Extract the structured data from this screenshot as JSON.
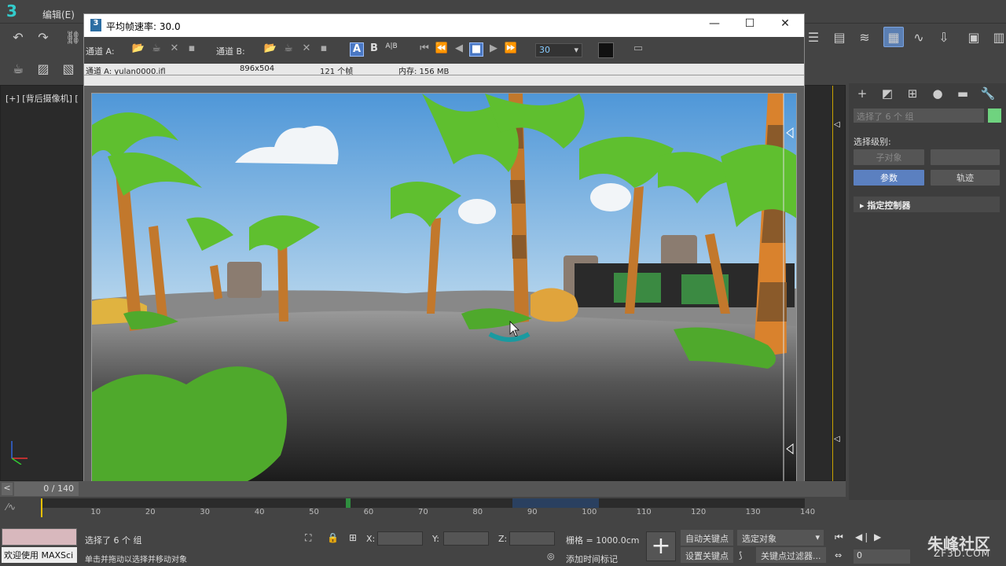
{
  "app": {
    "menu": [
      "编辑(E)"
    ],
    "viewport_label": "[+] [背后摄像机] [",
    "side": {
      "selection_text": "选择了 6 个 组",
      "select_level_label": "选择级别:",
      "sub_object_btn": "子对象",
      "params_btn": "参数",
      "track_btn": "轨迹",
      "rollout_title": "指定控制器"
    },
    "timeline": {
      "frame_readout": "0 / 140",
      "ticks": [
        "10",
        "20",
        "30",
        "40",
        "50",
        "60",
        "70",
        "80",
        "90",
        "100",
        "110",
        "120",
        "130",
        "140"
      ]
    },
    "status": {
      "selection": "选择了 6 个 组",
      "hint": "单击并拖动以选择并移动对象",
      "welcome": "欢迎使用 MAXSci",
      "x_label": "X:",
      "y_label": "Y:",
      "z_label": "Z:",
      "grid": "栅格 = 1000.0cm",
      "add_time_tag": "添加时间标记",
      "auto_key": "自动关键点",
      "set_key": "设置关键点",
      "selected_object": "选定对象",
      "key_filter": "关键点过滤器...",
      "frame_value": "0"
    },
    "watermark": {
      "brand": "朱峰社区",
      "url": "ZF3D.COM"
    }
  },
  "frame_window": {
    "title": "平均帧速率: 30.0",
    "icon_text": "3",
    "channel_a_label": "通道 A:",
    "channel_b_label": "通道 B:",
    "btn_a": "A",
    "btn_b": "B",
    "btn_ab": "A|B",
    "frame_rate": "30",
    "info": {
      "channel": "通道 A: yulan0000.ifl",
      "resolution": "896x504",
      "frames": "121 个帧",
      "memory": "内存: 156 MB"
    }
  },
  "colors": {
    "sky_top": "#4f97d8",
    "accent_blue": "#5b80c0",
    "selection_swatch": "#6fd37f",
    "gold_frame": "#c8a200"
  }
}
